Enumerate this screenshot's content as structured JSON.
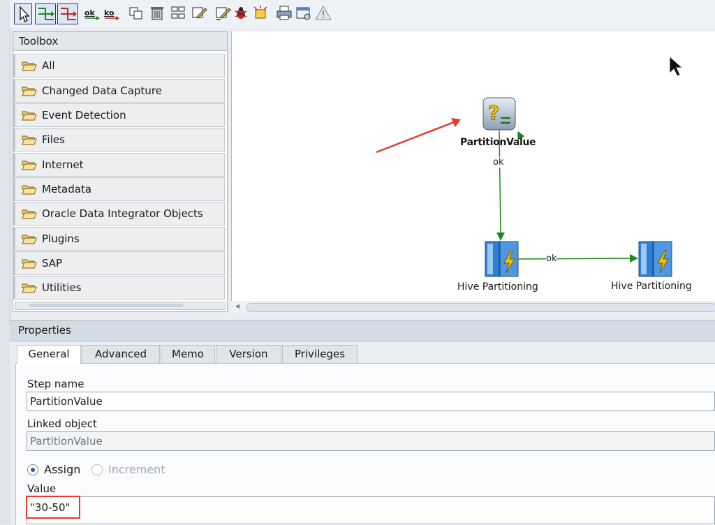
{
  "toolbar": {
    "ok_label": "ok",
    "ko_label": "ko"
  },
  "toolbox": {
    "title": "Toolbox",
    "categories": [
      {
        "label": "All"
      },
      {
        "label": "Changed Data Capture"
      },
      {
        "label": "Event Detection"
      },
      {
        "label": "Files"
      },
      {
        "label": "Internet"
      },
      {
        "label": "Metadata"
      },
      {
        "label": "Oracle Data Integrator Objects"
      },
      {
        "label": "Plugins"
      },
      {
        "label": "SAP"
      },
      {
        "label": "Utilities"
      }
    ]
  },
  "diagram": {
    "nodes": [
      {
        "label": "PartitionValue",
        "icon": "variable-icon"
      },
      {
        "label": "Hive Partitioning",
        "icon": "procedure-icon"
      },
      {
        "label": "Hive Partitioning",
        "icon": "procedure-icon"
      }
    ],
    "links": [
      {
        "label": "ok",
        "color": "#1f8a1f"
      },
      {
        "label": "ok",
        "color": "#1f8a1f"
      }
    ],
    "annotation_color": "#e53a2e"
  },
  "properties": {
    "title": "Properties",
    "tabs": [
      {
        "label": "General"
      },
      {
        "label": "Advanced"
      },
      {
        "label": "Memo"
      },
      {
        "label": "Version"
      },
      {
        "label": "Privileges"
      }
    ],
    "step_name_label": "Step name",
    "step_name_value": "PartitionValue",
    "linked_object_label": "Linked object",
    "linked_object_value": "PartitionValue",
    "radio_assign": "Assign",
    "radio_increment": "Increment",
    "value_label": "Value",
    "value_value": "\"30-50\""
  }
}
